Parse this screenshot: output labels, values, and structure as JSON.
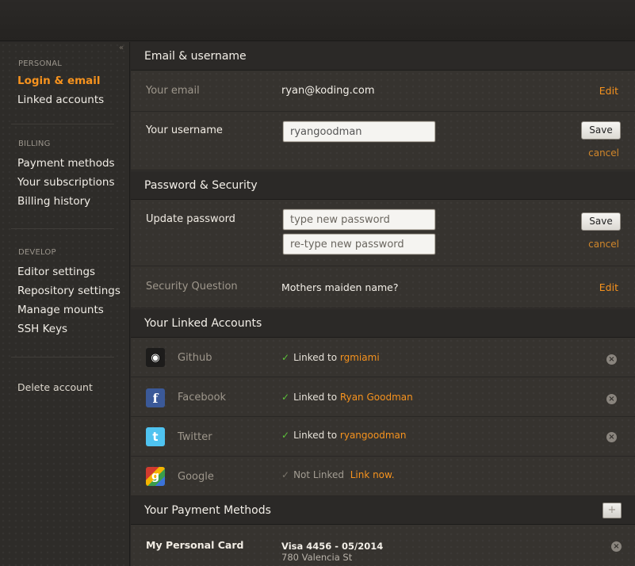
{
  "sidebar": {
    "collapse_glyph": "«",
    "groups": [
      {
        "heading": "PERSONAL",
        "items": [
          "Login & email",
          "Linked accounts"
        ]
      },
      {
        "heading": "BILLING",
        "items": [
          "Payment methods",
          "Your subscriptions",
          "Billing history"
        ]
      },
      {
        "heading": "DEVELOP",
        "items": [
          "Editor settings",
          "Repository settings",
          "Manage mounts",
          "SSH Keys"
        ]
      }
    ],
    "delete_label": "Delete account"
  },
  "email_section": {
    "title": "Email & username",
    "email_label": "Your email",
    "email_value": "ryan@koding.com",
    "edit_label": "Edit",
    "username_label": "Your username",
    "username_value": "ryangoodman",
    "save_label": "Save",
    "cancel_label": "cancel"
  },
  "password_section": {
    "title": "Password & Security",
    "update_label": "Update password",
    "new_placeholder": "type new password",
    "retype_placeholder": "re-type new password",
    "save_label": "Save",
    "cancel_label": "cancel",
    "question_label": "Security Question",
    "question_value": "Mothers maiden name?",
    "edit_label": "Edit"
  },
  "linked_section": {
    "title": "Your Linked Accounts",
    "linked_prefix": "Linked to",
    "accounts": [
      {
        "service": "Github",
        "user": "rgmiami",
        "icon": "github-icon"
      },
      {
        "service": "Facebook",
        "user": "Ryan Goodman",
        "icon": "facebook-icon"
      },
      {
        "service": "Twitter",
        "user": "ryangoodman",
        "icon": "twitter-icon"
      },
      {
        "service": "Google",
        "status": "Not Linked",
        "action": "Link now.",
        "icon": "google-icon"
      }
    ]
  },
  "payment_section": {
    "title": "Your Payment Methods",
    "add_glyph": "+",
    "card_label": "My Personal Card",
    "card_value": "Visa 4456 - 05/2014",
    "address_line1": "780 Valencia St"
  },
  "colors": {
    "accent": "#f7931e",
    "check": "#5cc23a",
    "background": "#33302d"
  }
}
